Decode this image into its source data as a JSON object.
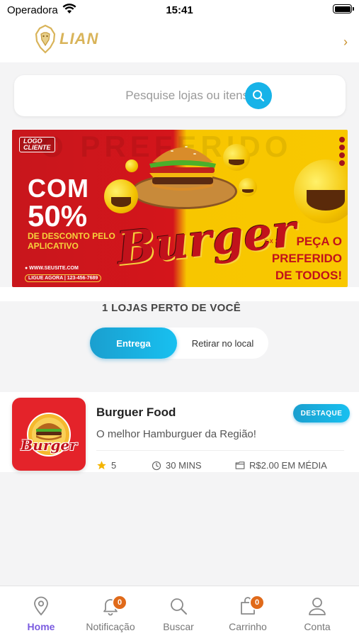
{
  "status_bar": {
    "carrier": "Operadora",
    "time": "15:41",
    "battery_level": 1.0
  },
  "header": {
    "brand": "LIAN",
    "logo_icon": "lion-logo-icon",
    "chevron_icon": "chevron-right-icon"
  },
  "search": {
    "placeholder": "Pesquise lojas ou itens ...",
    "icon": "search-icon"
  },
  "banner": {
    "logo_text": "LOGO\nCLIENTE",
    "line1": "COM",
    "line2": "50%",
    "description": "DE DESCONTO PELO APLICATIVO",
    "website": "● WWW.SEUSITE.COM",
    "phone": "LIGUE AGORA | 123-456-7689",
    "title": "Burger",
    "dots": "x x x",
    "cta": "PEÇA O PREFERIDO DE TODOS!",
    "background_word": "O PREFERIDO"
  },
  "stores_count": "1 LOJAS PERTO DE VOCÊ",
  "toggle": {
    "delivery": "Entrega",
    "pickup": "Retirar no local",
    "selected": "Entrega"
  },
  "store": {
    "name": "Burguer Food",
    "badge": "DESTAQUE",
    "description": "O melhor Hamburguer da Região!",
    "logo_text": "Burger",
    "rating": "5",
    "time": "30 MINS",
    "price": "R$2.00 EM MÉDIA",
    "rating_icon": "star-icon",
    "time_icon": "clock-icon",
    "price_icon": "wallet-icon"
  },
  "nav": {
    "items": [
      {
        "label": "Home",
        "icon": "location-pin-icon",
        "active": true
      },
      {
        "label": "Notificação",
        "icon": "bell-icon",
        "badge": "0"
      },
      {
        "label": "Buscar",
        "icon": "search-icon"
      },
      {
        "label": "Carrinho",
        "icon": "bag-icon",
        "badge": "0"
      },
      {
        "label": "Conta",
        "icon": "user-icon"
      }
    ]
  },
  "colors": {
    "accent": "#17b3e8",
    "active_nav": "#7a5be0",
    "badge": "#e06a1a",
    "brand_gold": "#d9b45a",
    "store_red": "#e4232a"
  }
}
